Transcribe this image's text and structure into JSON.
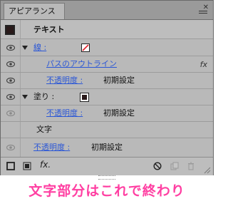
{
  "panel": {
    "tab_label": "アピアランス",
    "close_glyph": "✕",
    "header": {
      "title": "テキスト"
    },
    "rows": [
      {
        "label": "線 :"
      },
      {
        "label": "パスのアウトライン",
        "fx": "fx"
      },
      {
        "label": "不透明度 :",
        "value": "初期設定"
      },
      {
        "label": "塗り :"
      },
      {
        "label": "不透明度 :",
        "value": "初期設定"
      },
      {
        "label": "文字"
      },
      {
        "label": "不透明度 :",
        "value": "初期設定"
      }
    ],
    "bottom": {
      "fx_label": "fx."
    }
  },
  "colors": {
    "panel_bg": "#b9b9b9",
    "link": "#2b57d6",
    "stroke_swatch_slash": "#e0202a",
    "fill_swatch": "#2a1a1a",
    "caption": "#ff3fa2"
  },
  "caption": "文字部分はこれで終わり"
}
